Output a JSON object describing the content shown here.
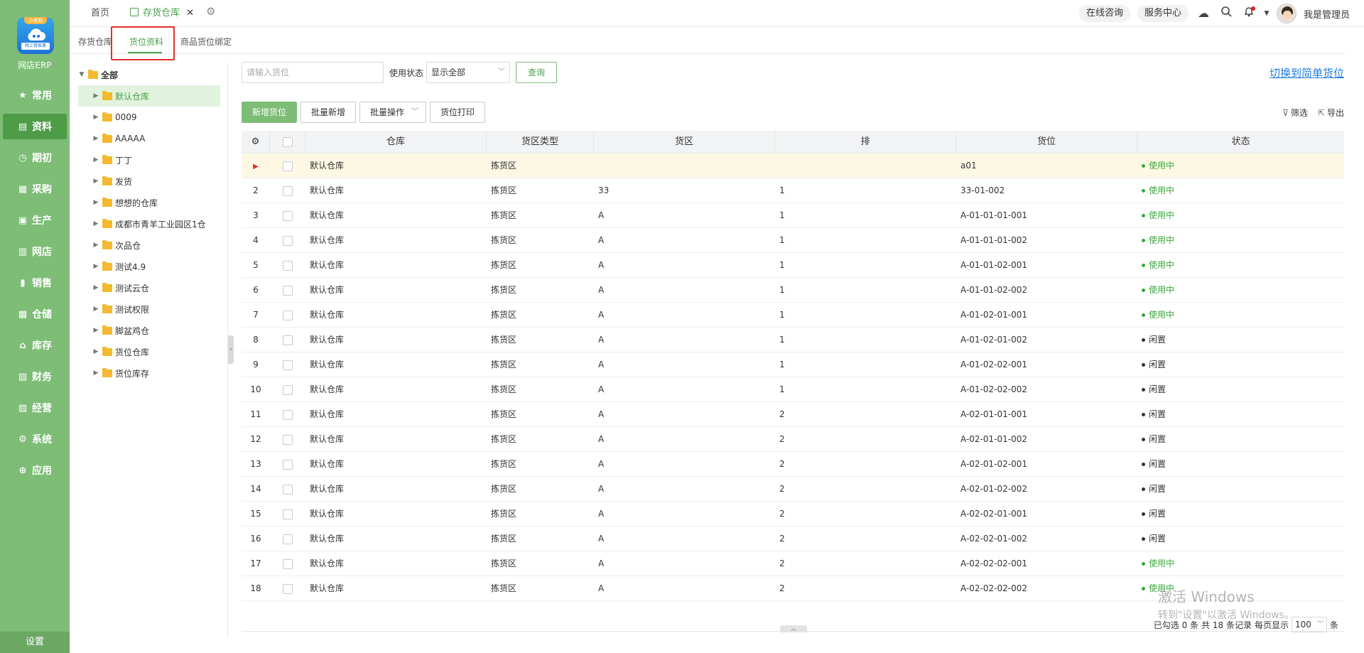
{
  "app": {
    "name": "网店ERP",
    "logo_top": "小老板",
    "logo_bottom": "网上管家婆"
  },
  "sidebar": {
    "items": [
      {
        "label": "常用",
        "icon": "star-icon",
        "glyph": "★"
      },
      {
        "label": "资料",
        "icon": "document-icon",
        "glyph": "▤",
        "active": true
      },
      {
        "label": "期初",
        "icon": "clock-icon",
        "glyph": "◷"
      },
      {
        "label": "采购",
        "icon": "purchase-icon",
        "glyph": "▦"
      },
      {
        "label": "生产",
        "icon": "production-icon",
        "glyph": "▣"
      },
      {
        "label": "网店",
        "icon": "shop-icon",
        "glyph": "▥"
      },
      {
        "label": "销售",
        "icon": "sales-chart-icon",
        "glyph": "▮"
      },
      {
        "label": "仓储",
        "icon": "warehouse-icon",
        "glyph": "▩"
      },
      {
        "label": "库存",
        "icon": "home-icon",
        "glyph": "⌂"
      },
      {
        "label": "财务",
        "icon": "finance-icon",
        "glyph": "▧"
      },
      {
        "label": "经营",
        "icon": "trend-icon",
        "glyph": "▨"
      },
      {
        "label": "系统",
        "icon": "gear-icon",
        "glyph": "⚙"
      },
      {
        "label": "应用",
        "icon": "plus-icon",
        "glyph": "⊕"
      }
    ],
    "settings_label": "设置"
  },
  "topbar": {
    "home_tab": "首页",
    "active_tab": "存货仓库",
    "close_glyph": "✕",
    "consult": "在线咨询",
    "service": "服务中心",
    "user": "我是管理员"
  },
  "subtabs": [
    "存货仓库",
    "货位资料",
    "商品货位绑定"
  ],
  "tree": {
    "root": "全部",
    "nodes": [
      "默认仓库",
      "0009",
      "AAAAA",
      "丁丁",
      "发货",
      "想想的仓库",
      "成都市青羊工业园区1仓",
      "次品仓",
      "测试4.9",
      "测试云仓",
      "测试权限",
      "脚盆鸡仓",
      "货位仓库",
      "货位库存"
    ]
  },
  "filters": {
    "location_placeholder": "请输入货位",
    "status_label": "使用状态",
    "status_value": "显示全部",
    "query_button": "查询",
    "switch_link": "切换到简单货位"
  },
  "actions": {
    "new": "新增货位",
    "batch_new": "批量新增",
    "batch_ops": "批量操作",
    "print": "货位打印",
    "filter": "筛选",
    "export": "导出"
  },
  "table": {
    "headers": [
      "仓库",
      "货区类型",
      "货区",
      "排",
      "货位",
      "状态"
    ],
    "rows": [
      {
        "no": "",
        "warehouse": "默认仓库",
        "type": "拣货区",
        "zone": "",
        "row": "",
        "location": "a01",
        "status": "使用中",
        "in_use": true
      },
      {
        "no": "2",
        "warehouse": "默认仓库",
        "type": "拣货区",
        "zone": "33",
        "row": "1",
        "location": "33-01-002",
        "status": "使用中",
        "in_use": true
      },
      {
        "no": "3",
        "warehouse": "默认仓库",
        "type": "拣货区",
        "zone": "A",
        "row": "1",
        "location": "A-01-01-01-001",
        "status": "使用中",
        "in_use": true
      },
      {
        "no": "4",
        "warehouse": "默认仓库",
        "type": "拣货区",
        "zone": "A",
        "row": "1",
        "location": "A-01-01-01-002",
        "status": "使用中",
        "in_use": true
      },
      {
        "no": "5",
        "warehouse": "默认仓库",
        "type": "拣货区",
        "zone": "A",
        "row": "1",
        "location": "A-01-01-02-001",
        "status": "使用中",
        "in_use": true
      },
      {
        "no": "6",
        "warehouse": "默认仓库",
        "type": "拣货区",
        "zone": "A",
        "row": "1",
        "location": "A-01-01-02-002",
        "status": "使用中",
        "in_use": true
      },
      {
        "no": "7",
        "warehouse": "默认仓库",
        "type": "拣货区",
        "zone": "A",
        "row": "1",
        "location": "A-01-02-01-001",
        "status": "使用中",
        "in_use": true
      },
      {
        "no": "8",
        "warehouse": "默认仓库",
        "type": "拣货区",
        "zone": "A",
        "row": "1",
        "location": "A-01-02-01-002",
        "status": "闲置",
        "in_use": false
      },
      {
        "no": "9",
        "warehouse": "默认仓库",
        "type": "拣货区",
        "zone": "A",
        "row": "1",
        "location": "A-01-02-02-001",
        "status": "闲置",
        "in_use": false
      },
      {
        "no": "10",
        "warehouse": "默认仓库",
        "type": "拣货区",
        "zone": "A",
        "row": "1",
        "location": "A-01-02-02-002",
        "status": "闲置",
        "in_use": false
      },
      {
        "no": "11",
        "warehouse": "默认仓库",
        "type": "拣货区",
        "zone": "A",
        "row": "2",
        "location": "A-02-01-01-001",
        "status": "闲置",
        "in_use": false
      },
      {
        "no": "12",
        "warehouse": "默认仓库",
        "type": "拣货区",
        "zone": "A",
        "row": "2",
        "location": "A-02-01-01-002",
        "status": "闲置",
        "in_use": false
      },
      {
        "no": "13",
        "warehouse": "默认仓库",
        "type": "拣货区",
        "zone": "A",
        "row": "2",
        "location": "A-02-01-02-001",
        "status": "闲置",
        "in_use": false
      },
      {
        "no": "14",
        "warehouse": "默认仓库",
        "type": "拣货区",
        "zone": "A",
        "row": "2",
        "location": "A-02-01-02-002",
        "status": "闲置",
        "in_use": false
      },
      {
        "no": "15",
        "warehouse": "默认仓库",
        "type": "拣货区",
        "zone": "A",
        "row": "2",
        "location": "A-02-02-01-001",
        "status": "闲置",
        "in_use": false
      },
      {
        "no": "16",
        "warehouse": "默认仓库",
        "type": "拣货区",
        "zone": "A",
        "row": "2",
        "location": "A-02-02-01-002",
        "status": "闲置",
        "in_use": false
      },
      {
        "no": "17",
        "warehouse": "默认仓库",
        "type": "拣货区",
        "zone": "A",
        "row": "2",
        "location": "A-02-02-02-001",
        "status": "使用中",
        "in_use": true
      },
      {
        "no": "18",
        "warehouse": "默认仓库",
        "type": "拣货区",
        "zone": "A",
        "row": "2",
        "location": "A-02-02-02-002",
        "status": "使用中",
        "in_use": true
      }
    ]
  },
  "pager": {
    "selected": "已勾选 0 条",
    "total": "共 18 条记录",
    "per_page_label": "每页显示",
    "page_size": "100",
    "unit": "条"
  },
  "watermark": {
    "line1": "激活 Windows",
    "line2": "转到\"设置\"以激活 Windows。"
  },
  "colors": {
    "sidebar": "#7dbd76",
    "accent": "#4aa04a",
    "in_use": "#3aa83a",
    "highlight": "#e0302a",
    "link": "#1e7be0"
  }
}
